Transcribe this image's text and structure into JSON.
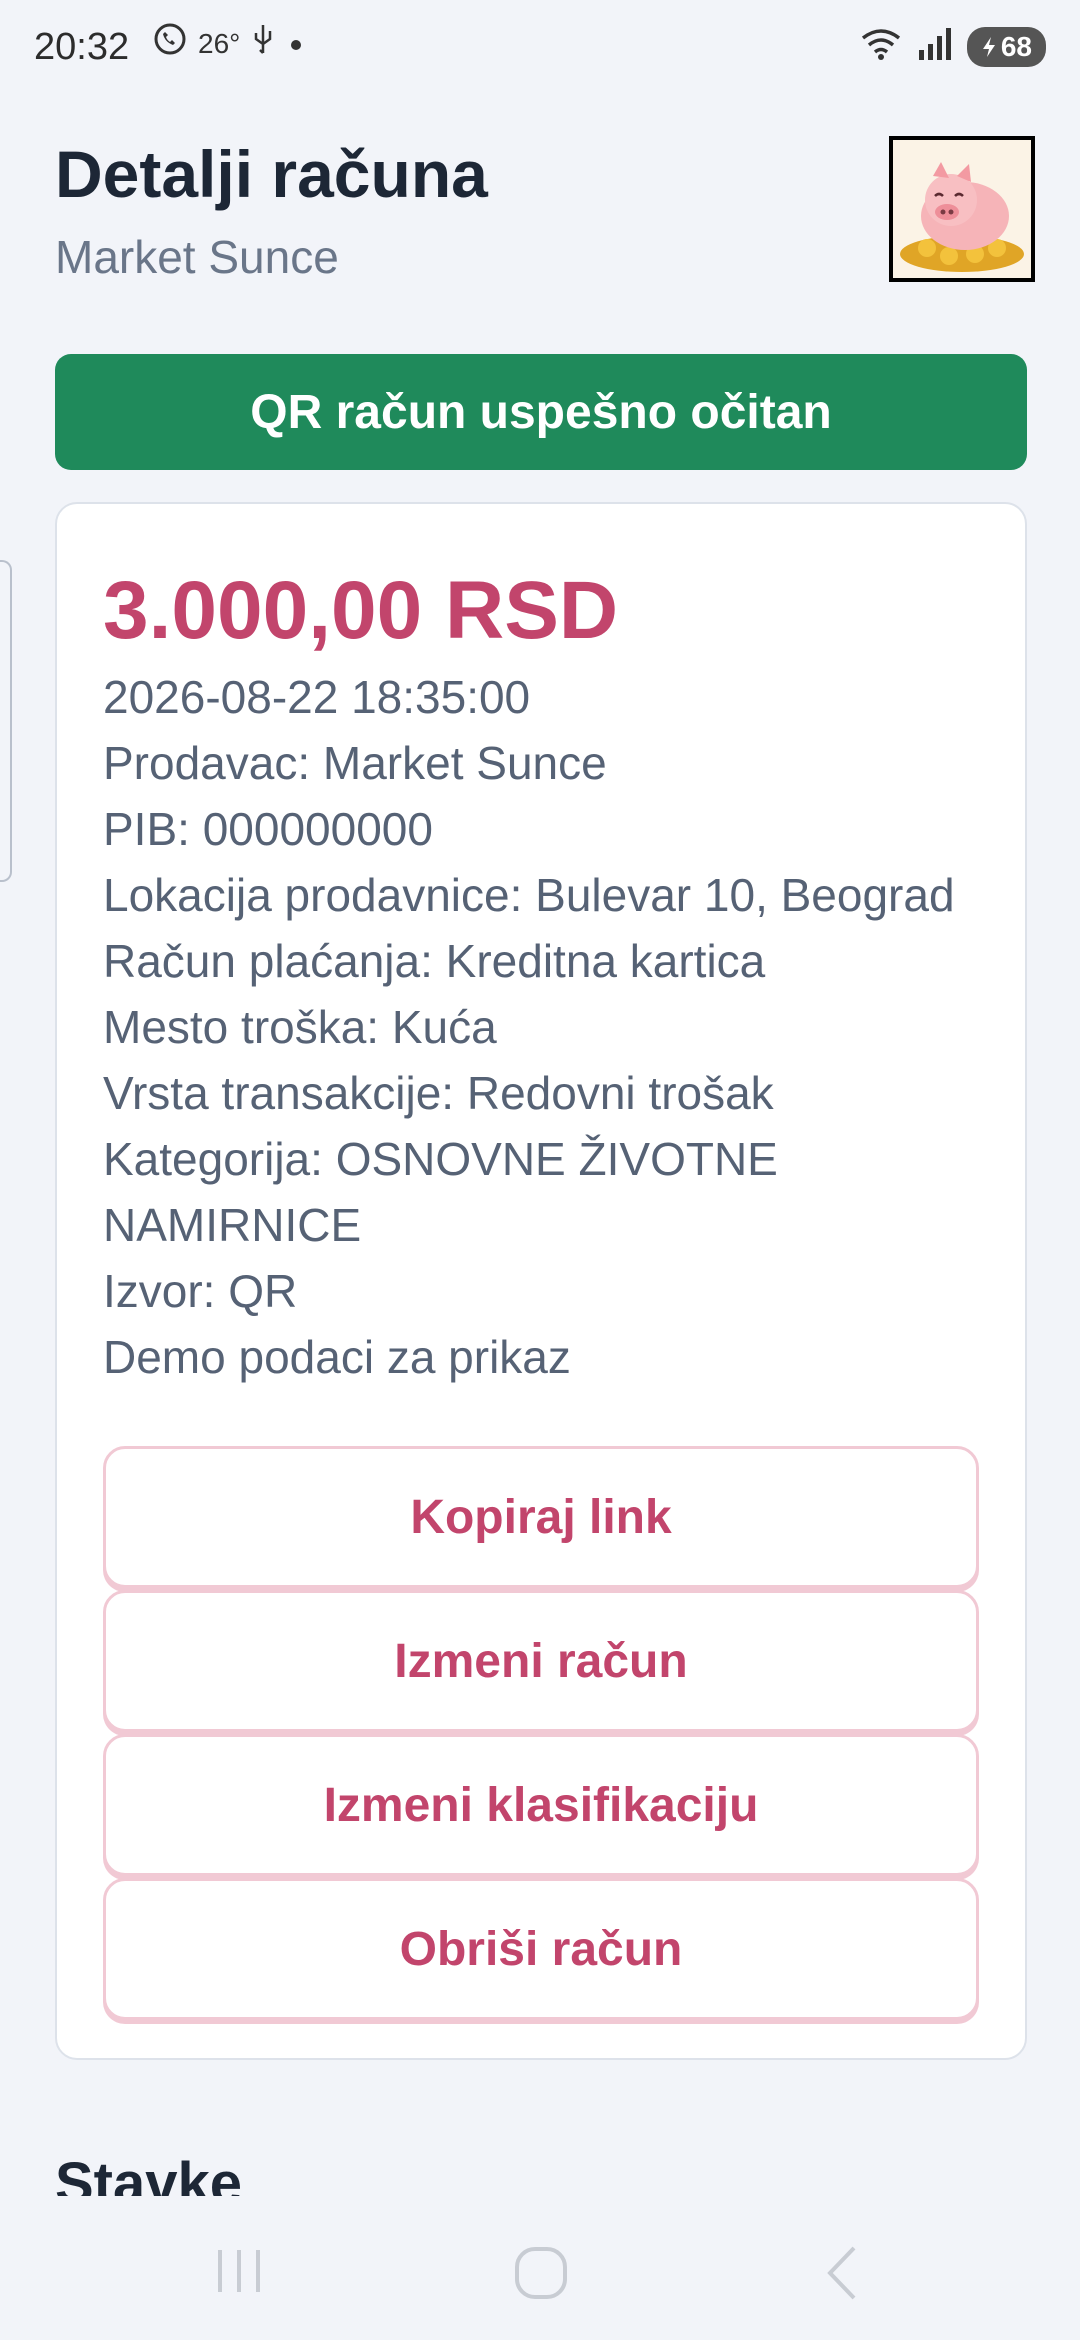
{
  "status_bar": {
    "time": "20:32",
    "temperature": "26°",
    "battery": "68",
    "icons": [
      "viber-icon",
      "usb-icon",
      "dot-icon",
      "wifi-icon",
      "signal-icon",
      "battery-icon"
    ]
  },
  "header": {
    "title": "Detalji računa",
    "subtitle": "Market Sunce"
  },
  "banner": {
    "text": "QR račun uspešno očitan",
    "color": "#1f8a5b"
  },
  "receipt": {
    "amount": "3.000,00 RSD",
    "lines": [
      "2026-08-22 18:35:00",
      "Prodavac: Market Sunce",
      "PIB: 000000000",
      "Lokacija prodavnice: Bulevar 10, Beograd",
      "Račun plaćanja: Kreditna kartica",
      "Mesto troška: Kuća",
      "Vrsta transakcije: Redovni trošak",
      "Kategorija: OSNOVNE ŽIVOTNE NAMIRNICE",
      "Izvor: QR",
      "Demo podaci za prikaz"
    ]
  },
  "actions": {
    "copy_link": "Kopiraj link",
    "edit_receipt": "Izmeni račun",
    "edit_classification": "Izmeni klasifikaciju",
    "delete_receipt": "Obriši račun"
  },
  "section": {
    "items_title": "Stavke"
  },
  "colors": {
    "accent": "#c2456c",
    "background": "#f2f4f9"
  }
}
